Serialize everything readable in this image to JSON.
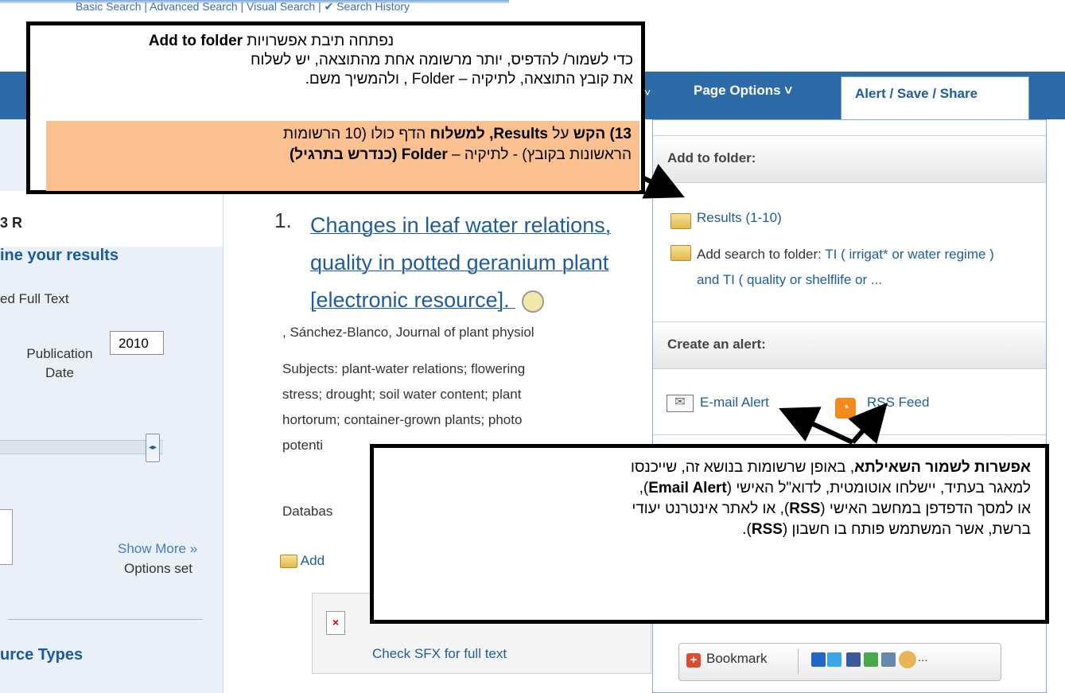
{
  "top_nav": {
    "text": "Basic Search  |  Advanced Search  |  Visual Search  |  ✔ Search History"
  },
  "sidebar": {
    "count_fragment": "3 R",
    "refine_heading": "ine your results",
    "full_text": "ed Full Text",
    "publication_date_label": "Publication Date",
    "year_value": "2010",
    "show_more": "Show More »",
    "options_set": "Options set",
    "source_types_heading": "urce Types"
  },
  "tabs": {
    "prev_chevron": "˅",
    "page_options": "Page Options ˅",
    "active_tab": "Alert / Save / Share"
  },
  "result": {
    "number": "1.",
    "title_line1": "Changes in leaf water relations,",
    "title_line2": "quality in potted geranium plant",
    "title_line3": "[electronic resource].",
    "author_line": ", Sánchez-Blanco, Journal of plant physiol",
    "subjects_line1": "Subjects: plant-water relations; flowering",
    "subjects_line2": "stress; drought; soil water content; plant",
    "subjects_line3": "hortorum; container-grown plants; photo",
    "subjects_line4": "potenti",
    "database_fragment": "Databas",
    "add_fragment": "Add",
    "sfx_link": "Check SFX for full text"
  },
  "panel": {
    "add_to_folder_heading": "Add to folder:",
    "results_link": "Results (1-10)",
    "add_search_prefix": "Add search to folder: ",
    "add_search_query": "TI ( irrigat* or water regime ) and TI ( quality or shelflife or ...",
    "create_alert_heading": "Create an alert:",
    "email_alert": "E-mail Alert",
    "rss_feed": "RSS Feed",
    "bookmark_label": "Bookmark",
    "bookmark_more": "..."
  },
  "callout_top": {
    "line1_prefix": "נפתחה תיבת אפשרויות ",
    "line1_bold": "Add to folder",
    "line2": "כדי לשמור/ להדפיס, יותר מרשומה אחת מהתוצאה, יש לשלוח",
    "line3": "את קובץ התוצאה, לתיקיה – Folder , ולהמשיך משם.",
    "step_a_bold": "13)  הקש",
    "step_a_mid": " על ",
    "step_a_bold2": "Results, למשלוח",
    "step_a_rest": " הדף כולו (10 הרשומות",
    "step_b_rest": "הראשונות בקובץ) - לתיקיה – ",
    "step_b_bold": "Folder  (כנדרש בתרגיל)"
  },
  "callout_bottom": {
    "bold1": "אפשרות לשמור השאילתא",
    "text1": ", באופן שרשומות בנושא זה, שייכנסו",
    "text2a": "למאגר בעתיד, יישלחו אוטומטית, לדוא\"ל האישי (",
    "bold2": "Email Alert",
    "text2b": "),",
    "text3a": "או למסך הדפדפן במחשב האישי (",
    "bold3": "RSS",
    "text3b": "), או לאתר אינטרנט יעודי",
    "text4a": "ברשת, אשר המשתמש פותח בו חשבון (",
    "bold4": "RSS",
    "text4b": ")."
  },
  "colors": {
    "brand_blue": "#2d6aa8",
    "link_blue": "#1f5c9e",
    "highlight_orange": "#fac090"
  }
}
